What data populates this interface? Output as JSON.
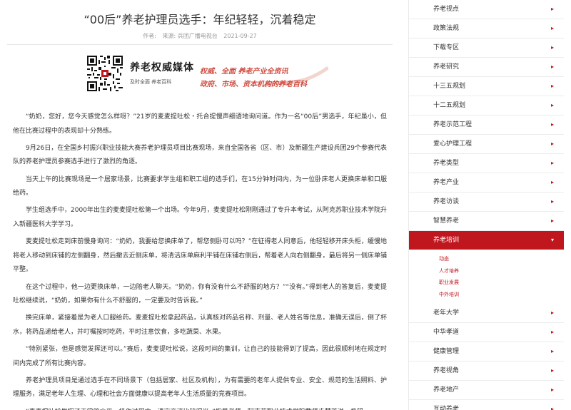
{
  "article": {
    "title": "“00后”养老护理员选手：年纪轻轻，沉着稳定",
    "meta": {
      "author": "作者:",
      "source": "来源: 兵团广播电视台",
      "date": "2021-09-27"
    },
    "paragraphs": [
      "“奶奶，您好，您今天感觉怎么样呀？”21岁的麦麦提吐松・托合提慢声细语地询问道。作为一名“00后”男选手，年纪虽小，但他在比赛过程中的表现却十分熟练。",
      "9月26日，在全国乡村振兴职业技能大赛养老护理员项目比赛现场，来自全国各省（区、市）及新疆生产建设兵团29个参赛代表队的养老护理员参赛选手进行了激烈的角逐。",
      "当天上午的比赛现场是一个居家场景，比赛要求学生组和职工组的选手们，在15分钟时间内，为一位卧床老人更换床单和口服给药。",
      "学生组选手中，2000年出生的麦麦提吐松第一个出场。今年9月，麦麦提吐松刚刚通过了专升本考试，从阿克苏职业技术学院升入新疆医科大学学习。",
      "麦麦提吐松走到床前慢身询问：“奶奶，我要给您换床单了，帮您侧卧可以吗？”在征得老人同意后，他轻轻移开床头柜，缓慢地将老人移动到床铺的左侧翻身，然后撤去近侧床单，将清洁床单麻利平铺在床铺右侧后，帮着老人向右侧翻身，最后将另一侧床单铺平整。",
      "在这个过程中，他一边更换床单，一边陪老人聊天。“奶奶，你有没有什么不舒服的地方？”“没有。”得到老人的答复后，麦麦提吐松继续说，“奶奶，如果你有什么不舒服的，一定要及时告诉我。”",
      "换完床单，紧接着是为老人口服给药。麦麦提吐松拿起药品，认真核对药品名称、剂量、老人姓名等信息，准确无误后，倒了杯水，将药品递给老人，并叮嘱按时吃药，平时注意饮食，多吃蔬菜、水果。",
      "“特别紧张，但是感觉发挥还可以。”赛后，麦麦提吐松说，这段时间的集训，让自己的技能得到了提高，因此很顺利地在规定时间内完成了所有比赛内容。",
      "养老护理员项目是通过选手在不同场景下（包括居家、社区及机构），为有需要的老年人提供专业、安全、规范的生活照料、护理服务，满足老年人生理、心理和社会方面健康以提高老年人生活质量的竞赛项目。",
      "“麦麦提吐松发挥了正常的水平，操作过程中，语言交流比较得当。”指导老师、阿克苏职业技术学院教师步慧芳说，希望"
    ]
  },
  "banner": {
    "brand": "养老权威媒体",
    "brand_sub": "及时全面 养老百科",
    "slogan_line1": "权威、全面  养老产业全资讯",
    "slogan_line2": "政府、市场、资本机构的养老百科"
  },
  "sidebar": {
    "items_top": [
      "养老视点",
      "政策法规",
      "下载专区",
      "养老研究",
      "十三五规划",
      "十二五规划",
      "养老示范工程",
      "爱心护理工程",
      "养老类型",
      "养老产业",
      "养老访谈",
      "智慧养老"
    ],
    "active": "养老培训",
    "sub_items": [
      "动态",
      "人才培养",
      "职业发展",
      "中外培训"
    ],
    "items_bottom": [
      "老年大学",
      "中华孝道",
      "健康管理",
      "养老视角",
      "养老地产",
      "互动养老"
    ]
  },
  "colors": {
    "accent": "#c0161e",
    "slogan": "#d04a3e"
  },
  "icons": {
    "arrow": "right-triangle",
    "active_arrow": "down-triangle"
  }
}
